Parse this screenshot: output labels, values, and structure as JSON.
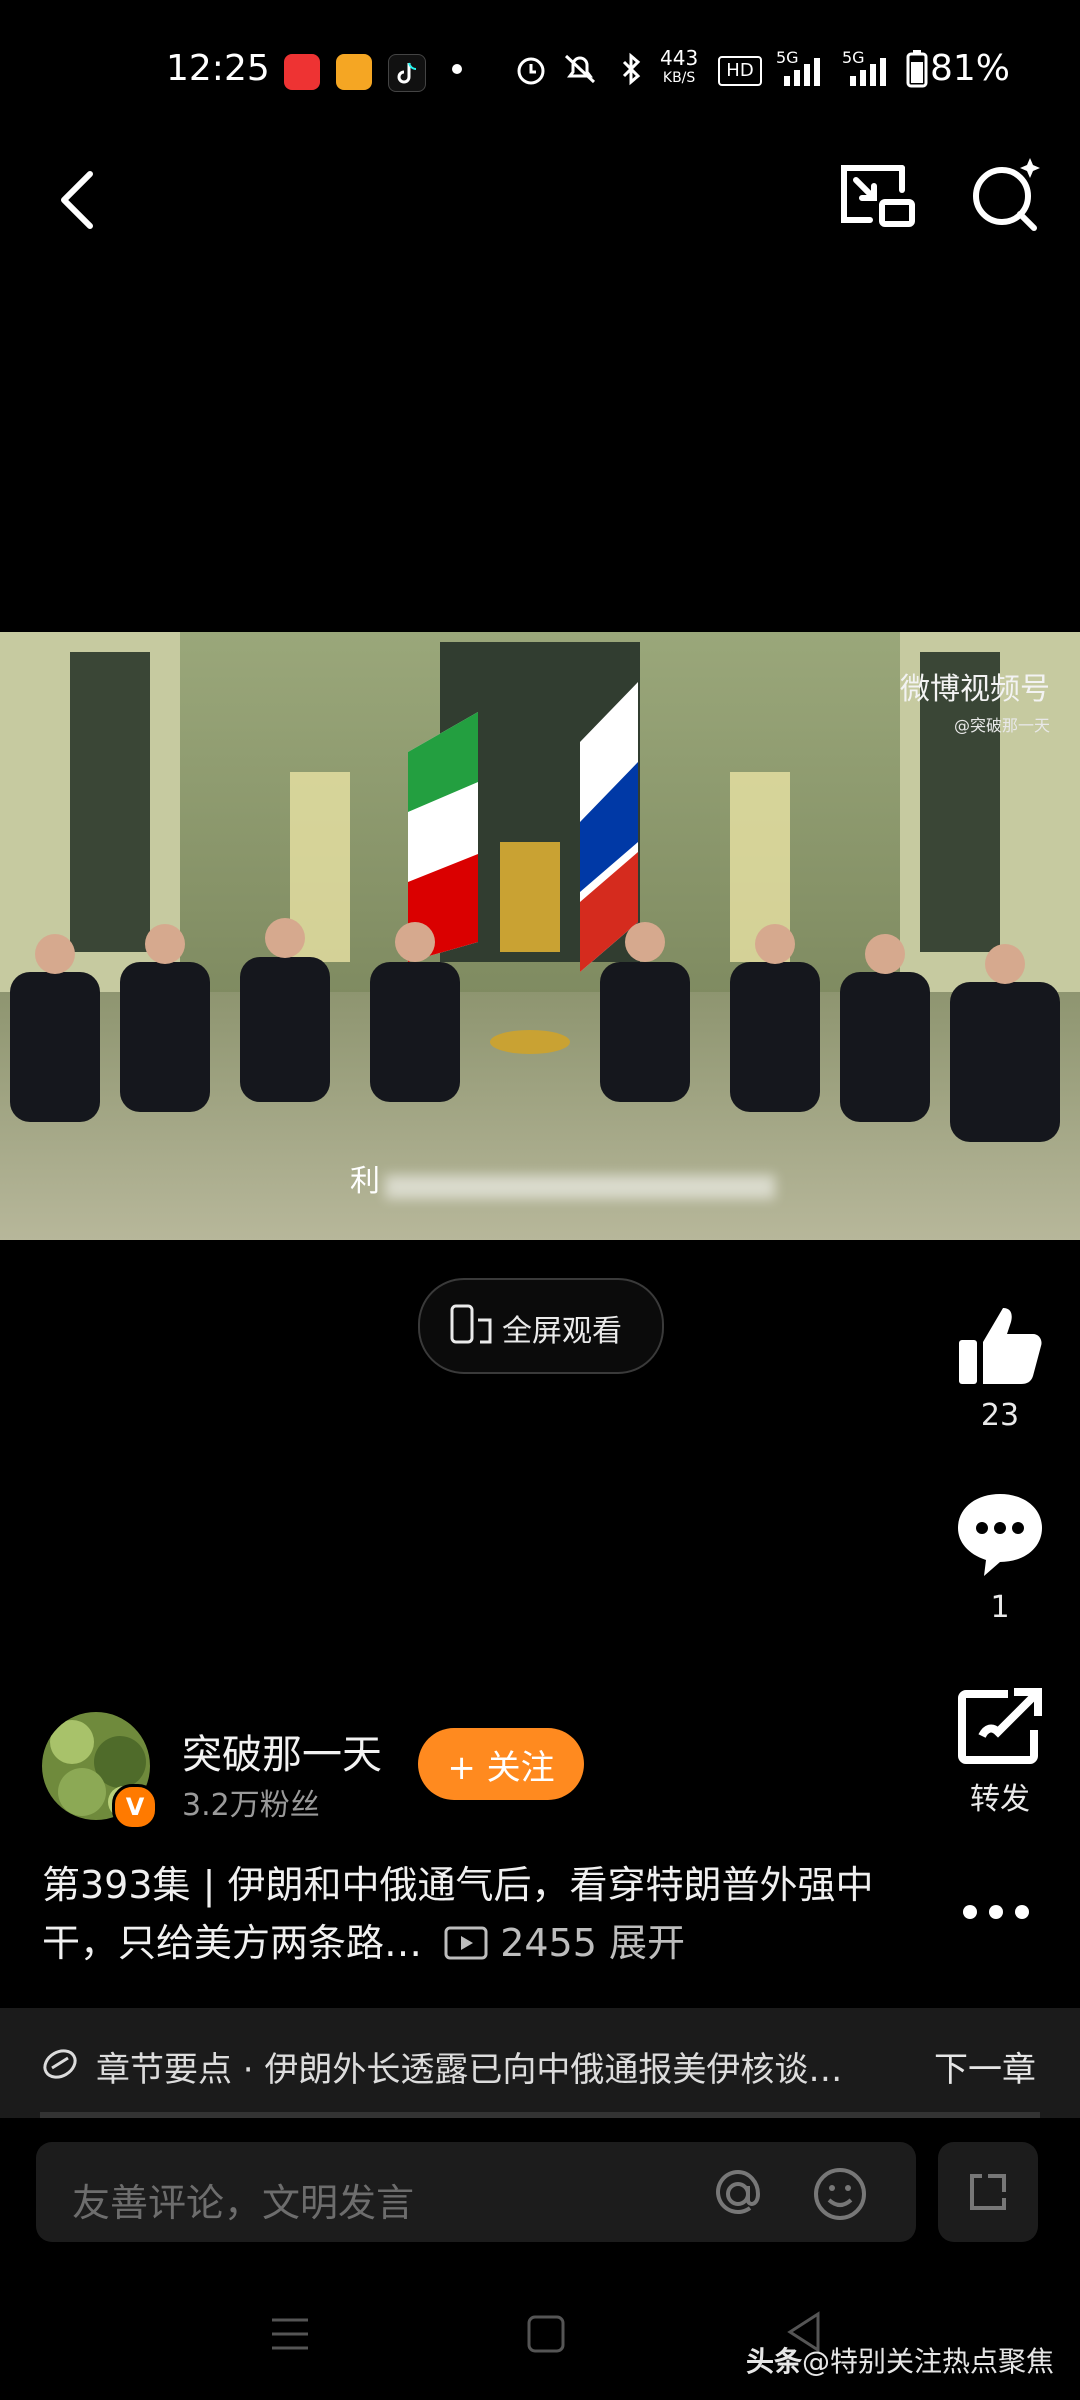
{
  "status_bar": {
    "time": "12:25",
    "net_speed_top": "443",
    "net_speed_bottom": "KB/S",
    "hd": "HD",
    "sig1": "5G",
    "sig2": "5G",
    "battery": "81%"
  },
  "watermark": {
    "brand": "微博视频号",
    "handle": "@突破那一天"
  },
  "video": {
    "subtitle_char": "利"
  },
  "fullscreen": {
    "label": "全屏观看"
  },
  "rail": {
    "like_count": "23",
    "comment_count": "1",
    "share_label": "转发"
  },
  "author": {
    "name": "突破那一天",
    "fans": "3.2万粉丝",
    "follow_label": "+ 关注",
    "badge": "V"
  },
  "post": {
    "title": "第393集 | 伊朗和中俄通气后，看穿特朗普外强中干，只给美方两条路…",
    "views": "2455",
    "expand": "展开"
  },
  "chapter": {
    "text": "章节要点 · 伊朗外长透露已向中俄通报美伊核谈…",
    "next": "下一章"
  },
  "comment": {
    "placeholder": "友善评论，文明发言"
  },
  "credit": {
    "brand": "头条",
    "handle": "@特别关注热点聚焦"
  },
  "colors": {
    "accent": "#ff8a1f",
    "background": "#000000"
  }
}
